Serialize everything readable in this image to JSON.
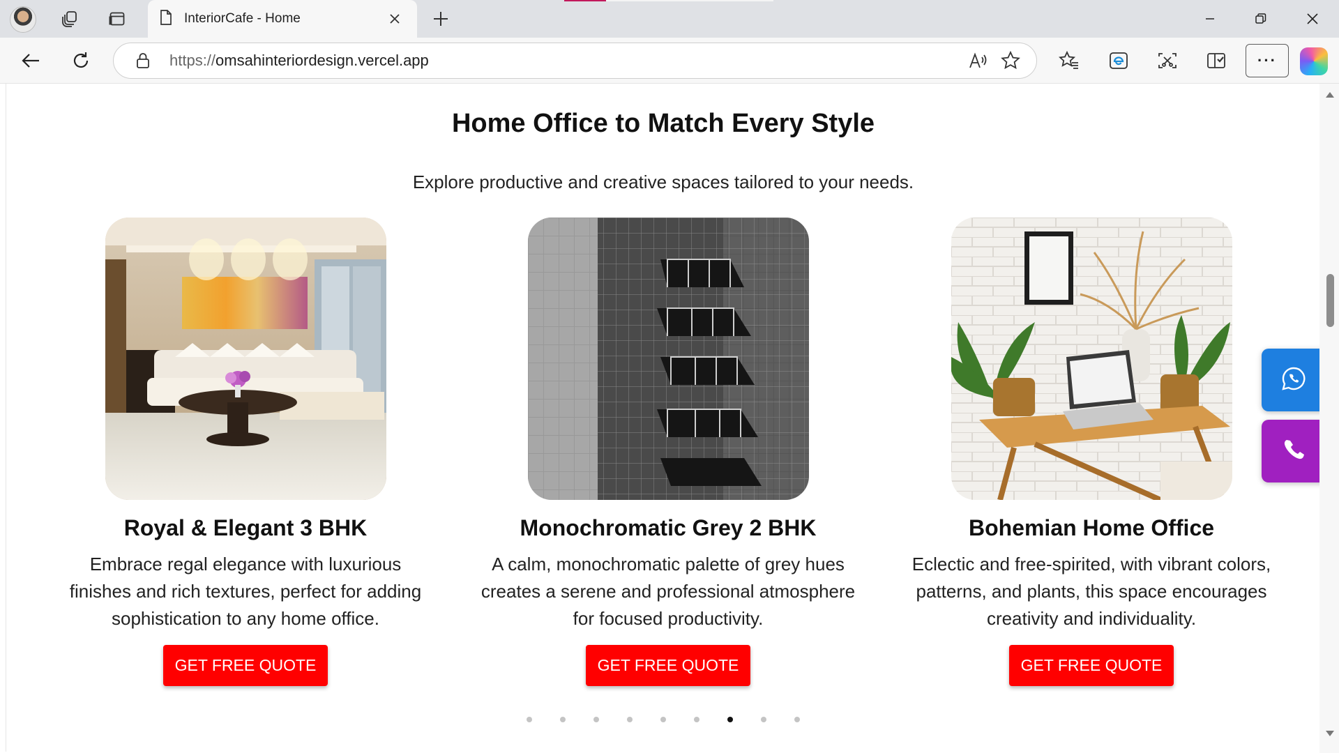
{
  "browser": {
    "tab_title": "InteriorCafe - Home",
    "url_protocol": "https://",
    "url_host": "omsahinteriordesign.vercel.app",
    "more_label": "···"
  },
  "section": {
    "title": "Home Office to Match Every Style",
    "subtitle": "Explore productive and creative spaces tailored to your needs."
  },
  "cards": [
    {
      "title": "Royal & Elegant 3 BHK",
      "description": "Embrace regal elegance with luxurious finishes and rich textures, perfect for adding sophistication to any home office.",
      "cta": "GET FREE QUOTE",
      "image": "luxury-living-room-photo"
    },
    {
      "title": "Monochromatic Grey 2 BHK",
      "description": "A calm, monochromatic palette of grey hues creates a serene and professional atmosphere for focused productivity.",
      "cta": "GET FREE QUOTE",
      "image": "grey-building-balconies-photo"
    },
    {
      "title": "Bohemian Home Office",
      "description": "Eclectic and free-spirited, with vibrant colors, patterns, and plants, this space encourages creativity and individuality.",
      "cta": "GET FREE QUOTE",
      "image": "bohemian-desk-laptop-plants-photo"
    }
  ],
  "carousel": {
    "dot_count": 9,
    "active_dot_index": 6
  },
  "colors": {
    "cta_red": "#ff0000",
    "whatsapp_blue": "#1e7fe0",
    "phone_purple": "#a020c0"
  },
  "floating": {
    "whatsapp_icon": "whatsapp-icon",
    "phone_icon": "phone-icon"
  }
}
